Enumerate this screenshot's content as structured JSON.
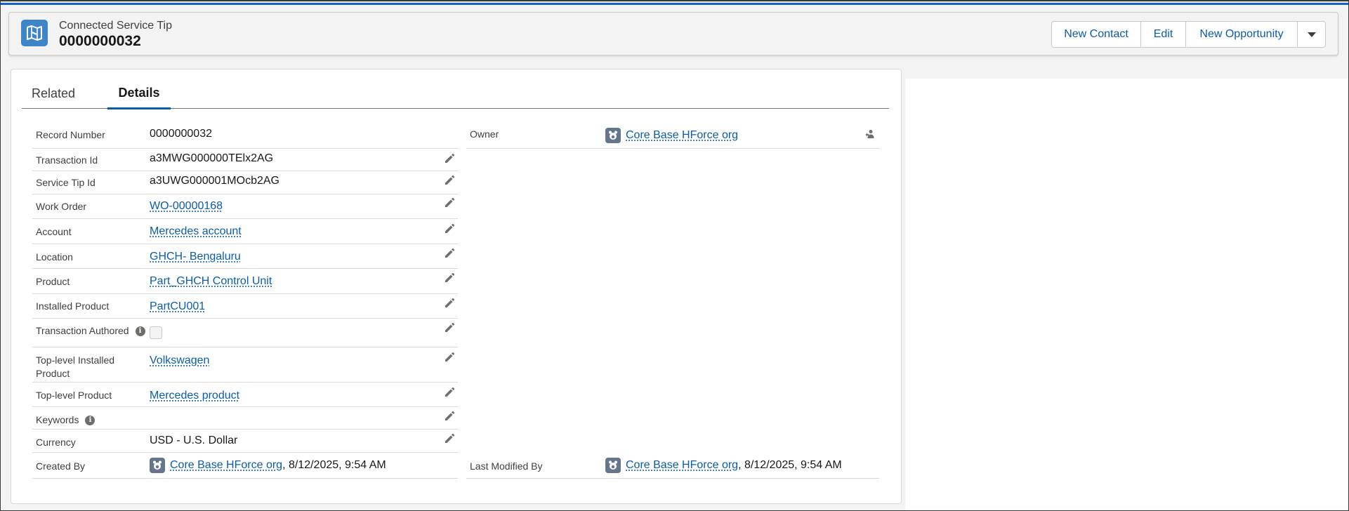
{
  "header": {
    "object_type": "Connected Service Tip",
    "record_name": "0000000032",
    "buttons": {
      "new_contact": "New Contact",
      "edit": "Edit",
      "new_opportunity": "New Opportunity"
    }
  },
  "tabs": {
    "related": "Related",
    "details": "Details"
  },
  "fields": {
    "record_number": {
      "label": "Record Number",
      "value": "0000000032"
    },
    "transaction_id": {
      "label": "Transaction Id",
      "value": "a3MWG000000TElx2AG"
    },
    "service_tip_id": {
      "label": "Service Tip Id",
      "value": "a3UWG000001MOcb2AG"
    },
    "work_order": {
      "label": "Work Order",
      "value": "WO-00000168"
    },
    "account": {
      "label": "Account",
      "value": "Mercedes account"
    },
    "location": {
      "label": "Location",
      "value": "GHCH- Bengaluru"
    },
    "product": {
      "label": "Product",
      "value": "Part_GHCH Control Unit"
    },
    "installed_product": {
      "label": "Installed Product",
      "value": "PartCU001"
    },
    "transaction_authored": {
      "label": "Transaction Authored",
      "value": ""
    },
    "top_level_installed_product": {
      "label_line1": "Top-level Installed",
      "label_line2": "Product",
      "value": "Volkswagen"
    },
    "top_level_product": {
      "label": "Top-level Product",
      "value": "Mercedes product"
    },
    "keywords": {
      "label": "Keywords",
      "value": ""
    },
    "currency": {
      "label": "Currency",
      "value": "USD - U.S. Dollar"
    },
    "created_by": {
      "label": "Created By",
      "user": "Core Base HForce org",
      "date": ", 8/12/2025, 9:54 AM"
    },
    "owner": {
      "label": "Owner",
      "user": "Core Base HForce org"
    },
    "last_modified_by": {
      "label": "Last Modified By",
      "user": "Core Base HForce org",
      "date": ", 8/12/2025, 9:54 AM"
    }
  },
  "colors": {
    "brand": "#0b5cab",
    "object_icon": "#3e84c7",
    "avatar": "#65758e"
  }
}
